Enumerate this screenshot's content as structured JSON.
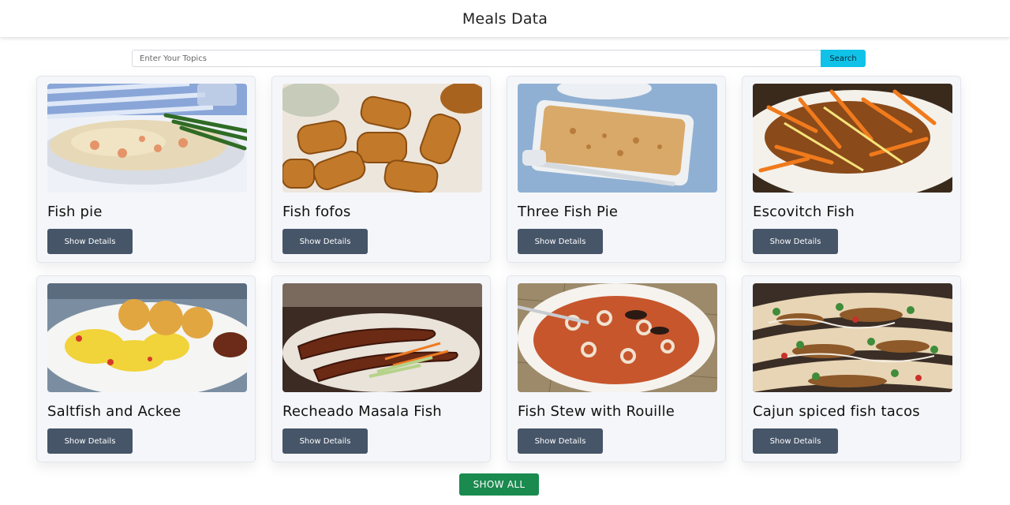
{
  "header": {
    "title": "Meals Data"
  },
  "search": {
    "placeholder": "Enter Your Topics",
    "value": "",
    "button_label": "Search"
  },
  "meals": [
    {
      "name": "Fish pie",
      "button_label": "Show Details"
    },
    {
      "name": "Fish fofos",
      "button_label": "Show Details"
    },
    {
      "name": "Three Fish Pie",
      "button_label": "Show Details"
    },
    {
      "name": "Escovitch Fish",
      "button_label": "Show Details"
    },
    {
      "name": "Saltfish and Ackee",
      "button_label": "Show Details"
    },
    {
      "name": "Recheado Masala Fish",
      "button_label": "Show Details"
    },
    {
      "name": "Fish Stew with Rouille",
      "button_label": "Show Details"
    },
    {
      "name": "Cajun spiced fish tacos",
      "button_label": "Show Details"
    }
  ],
  "footer": {
    "show_all_label": "SHOW ALL"
  },
  "colors": {
    "search_button": "#10c2e8",
    "details_button": "#465568",
    "show_all_button": "#1a8a4f",
    "card_background": "#f5f6fa"
  }
}
